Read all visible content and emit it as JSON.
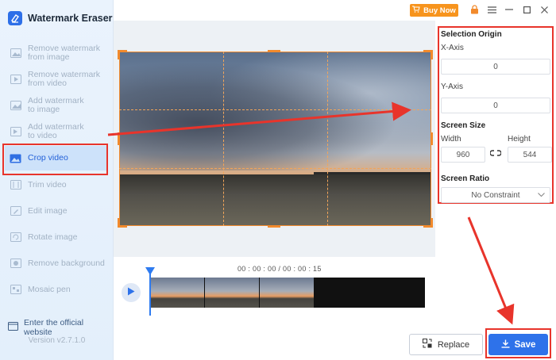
{
  "app": {
    "title": "Watermark Eraser",
    "version": "Version v2.7.1.0",
    "official_link": "Enter the official website"
  },
  "topbar": {
    "buy_label": "Buy Now"
  },
  "sidebar": {
    "items": [
      {
        "line1": "Remove watermark",
        "line2": "from image"
      },
      {
        "line1": "Remove watermark",
        "line2": "from video"
      },
      {
        "line1": "Add watermark",
        "line2": "to image"
      },
      {
        "line1": "Add watermark",
        "line2": "to video"
      },
      {
        "line1": "Crop video",
        "line2": ""
      },
      {
        "line1": "Trim video",
        "line2": ""
      },
      {
        "line1": "Edit image",
        "line2": ""
      },
      {
        "line1": "Rotate image",
        "line2": ""
      },
      {
        "line1": "Remove background",
        "line2": ""
      },
      {
        "line1": "Mosaic pen",
        "line2": ""
      }
    ]
  },
  "timeline": {
    "timecode": "00 : 00 : 00 / 00 : 00 : 15"
  },
  "panel": {
    "selection_origin": "Selection Origin",
    "x_axis_label": "X-Axis",
    "x_axis_value": "0",
    "y_axis_label": "Y-Axis",
    "y_axis_value": "0",
    "screen_size": "Screen Size",
    "width_label": "Width",
    "width_value": "960",
    "height_label": "Height",
    "height_value": "544",
    "screen_ratio": "Screen Ratio",
    "ratio_value": "No Constraint"
  },
  "actions": {
    "replace_label": "Replace",
    "save_label": "Save"
  },
  "colors": {
    "accent": "#2e72ea",
    "annotation": "#e8342b",
    "crop": "#f28a2c",
    "buy": "#f7941d"
  }
}
